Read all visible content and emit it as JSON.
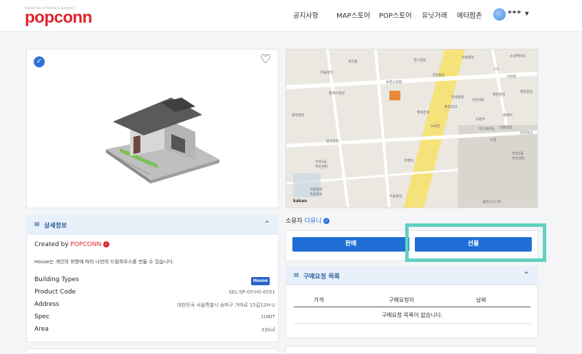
{
  "header": {
    "logo_tagline": "Digital Twin of Realty & Economy",
    "logo_text": "popconn",
    "nav": [
      "공지사항",
      "MAP스토어",
      "POP스토어",
      "유닛거래",
      "에타팜존"
    ],
    "user": "***"
  },
  "product": {
    "verified_icon": "check-circle-icon",
    "like_icon": "heart-outline-icon"
  },
  "map": {
    "labels": [
      "소년케이트",
      "수림빌딩",
      "대치동",
      "한스빌딩",
      "CU",
      "가빈채",
      "제일빌딩",
      "라움빌딩",
      "팔레스빌딩",
      "로엔스모텔",
      "국일빌딩",
      "에덴빌딩",
      "연세정형",
      "이안세르",
      "행복한세",
      "정형외과",
      "수협",
      "오렌지",
      "둘레터",
      "뉴욕칸",
      "남정빌딩",
      "하나로마트",
      "리치하이",
      "광휘빌딩",
      "삼성빌딩",
      "거여1동",
      "주민센터",
      "파출소",
      "서울중랑",
      "초등학교",
      "거송빌딩",
      "송파시그니처",
      "마천1동",
      "주민센터"
    ],
    "map_logo": "kakao"
  },
  "detail": {
    "title": "상세정보",
    "created_by_prefix": "Created by",
    "creator": "POPCONN",
    "description": "House는 개인의 취향에 따라 나만의 드림하우스를 만들 수 있습니다.",
    "rows": [
      {
        "label": "Building Types",
        "value": "House"
      },
      {
        "label": "Product Code",
        "value": "SEL-SP-GY-HS-0551"
      },
      {
        "label": "Address",
        "value": "대한민국 서울특별시 송파구 거마로 15길12H-U"
      },
      {
        "label": "Spec",
        "value": "1UNIT"
      },
      {
        "label": "Area",
        "value": "330㎡"
      }
    ]
  },
  "owner": {
    "prefix": "소유자",
    "name": "다유니"
  },
  "actions": {
    "sell": "판매",
    "gift": "선물"
  },
  "requests": {
    "title": "구매요청 목록",
    "columns": [
      "가격",
      "구매요청자",
      "날짜"
    ],
    "empty": "구매요청 목록이 없습니다."
  },
  "colors": {
    "brand": "#e0242c",
    "primary": "#1f6fd6",
    "highlight": "#5fd0c0"
  }
}
